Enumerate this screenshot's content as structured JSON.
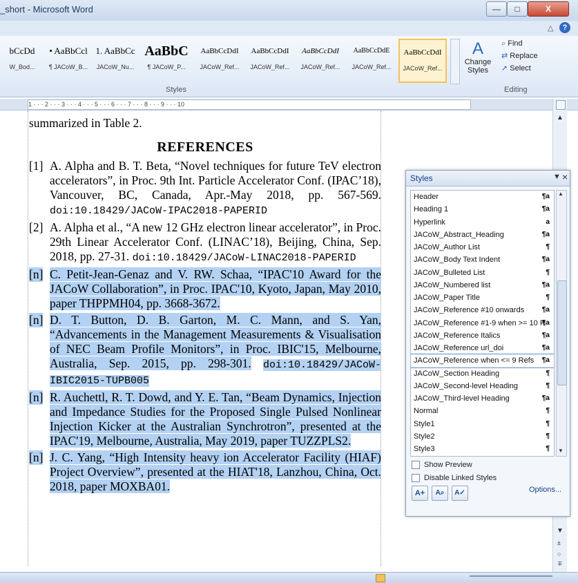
{
  "window": {
    "title": "_short - Microsoft Word",
    "minimize": "—",
    "maximize": "□",
    "close": "X",
    "help": "?",
    "collapse": "△"
  },
  "ribbon": {
    "styles_group_label": "Styles",
    "editing_group_label": "Editing",
    "gallery": [
      {
        "preview": "bCcDd",
        "name": "W_Bod..."
      },
      {
        "preview": "• AaBbCcl",
        "name": "¶ JACoW_B..."
      },
      {
        "preview": "1. AaBbCc",
        "name": "JACoW_Nu..."
      },
      {
        "preview": "AaBbC",
        "name": "¶ JACoW_P..."
      },
      {
        "preview": "AaBbCcDdI",
        "name": "JACoW_Ref..."
      },
      {
        "preview": "AaBbCcDdI",
        "name": "JACoW_Ref..."
      },
      {
        "preview": "AaBbCcDdI",
        "name": "JACoW_Ref..."
      },
      {
        "preview": "AaBbCcDdE",
        "name": "JACoW_Ref..."
      },
      {
        "preview": "AaBbCcDdI",
        "name": "JACoW_Ref..."
      }
    ],
    "change_styles": "Change Styles",
    "find": "Find",
    "replace": "Replace",
    "select": "Select"
  },
  "ruler": {
    "marks": "1 · · · 2 · · · 3 · · · 4 · · · 5 · · · 6 · · · 7 · · · 8 · · · 9 · · · 10"
  },
  "document": {
    "intro": "summarized in Table 2.",
    "heading": "REFERENCES",
    "refs": [
      {
        "num": "[1]",
        "text": "A. Alpha and B. T. Beta, “Novel techniques for future TeV electron accelerators”, in Proc. 9th Int. Particle Accelerator Conf. (IPAC’18), Vancouver, BC, Canada, Apr.-May 2018, pp. 567-569.",
        "doi": "doi:10.18429/JACoW-IPAC2018-PAPERID"
      },
      {
        "num": "[2]",
        "text": "A. Alpha et al., “A new 12 GHz electron linear accelerator”, in Proc. 29th Linear Accelerator Conf. (LINAC’18), Beijing, China, Sep. 2018, pp. 27-31.",
        "doi": "doi:10.18429/JACoW-LINAC2018-PAPERID"
      },
      {
        "num": "[n]",
        "text": "C. Petit-Jean-Genaz and V. RW. Schaa, “IPAC'10 Award for the JACoW Collaboration”, in Proc. IPAC'10, Kyoto, Japan, May 2010, paper THPPMH04, pp. 3668-3672.",
        "doi": ""
      },
      {
        "num": "[n]",
        "text": "D. T. Button, D. B. Garton, M. C. Mann, and S. Yan, “Advancements in the Management Measurements & Visualisation of NEC Beam Profile Monitors”, in Proc. IBIC'15, Melbourne, Australia, Sep. 2015, pp. 298-301.",
        "doi": "doi:10.18429/JACoW-IBIC2015-TUPB005"
      },
      {
        "num": "[n]",
        "text": "R. Auchettl, R. T. Dowd, and Y. E. Tan, “Beam Dynamics, Injection and Impedance Studies for the Proposed Single Pulsed Nonlinear Injection Kicker at the Australian Synchrotron”, presented at the IPAC'19, Melbourne, Australia, May 2019, paper TUZZPLS2.",
        "doi": ""
      },
      {
        "num": "[n]",
        "text": "J. C. Yang, “High Intensity heavy ion Accelerator Facility (HIAF) Project Overview”, presented at the HIAT'18, Lanzhou, China, Oct. 2018, paper MOXBA01.",
        "doi": ""
      }
    ]
  },
  "styles_pane": {
    "title": "Styles",
    "items": [
      {
        "name": "Header",
        "mark": "¶a"
      },
      {
        "name": "Heading 1",
        "mark": "¶a"
      },
      {
        "name": "Hyperlink",
        "mark": "a"
      },
      {
        "name": "JACoW_Abstract_Heading",
        "mark": "¶a"
      },
      {
        "name": "JACoW_Author List",
        "mark": "¶"
      },
      {
        "name": "JACoW_Body Text Indent",
        "mark": "¶a"
      },
      {
        "name": "JACoW_Bulleted List",
        "mark": "¶"
      },
      {
        "name": "JACoW_Numbered list",
        "mark": "¶a"
      },
      {
        "name": "JACoW_Paper Title",
        "mark": "¶"
      },
      {
        "name": "JACoW_Reference #10 onwards",
        "mark": "¶a"
      },
      {
        "name": "JACoW_Reference #1-9 when >= 10 R",
        "mark": "¶a"
      },
      {
        "name": "JACoW_Reference Italics",
        "mark": "¶a"
      },
      {
        "name": "JACoW_Reference url_doi",
        "mark": "¶a"
      },
      {
        "name": "JACoW_Reference when <= 9 Refs",
        "mark": "¶a"
      },
      {
        "name": "JACoW_Section Heading",
        "mark": "¶"
      },
      {
        "name": "JACoW_Second-level Heading",
        "mark": "¶"
      },
      {
        "name": "JACoW_Third-level Heading",
        "mark": "¶a"
      },
      {
        "name": "Normal",
        "mark": "¶"
      },
      {
        "name": "Style1",
        "mark": "¶"
      },
      {
        "name": "Style2",
        "mark": "¶"
      },
      {
        "name": "Style3",
        "mark": "¶"
      }
    ],
    "selected_item": "JACoW_Reference when <= 9 Refs",
    "show_preview": "Show Preview",
    "disable_linked": "Disable Linked Styles",
    "options": "Options..."
  }
}
